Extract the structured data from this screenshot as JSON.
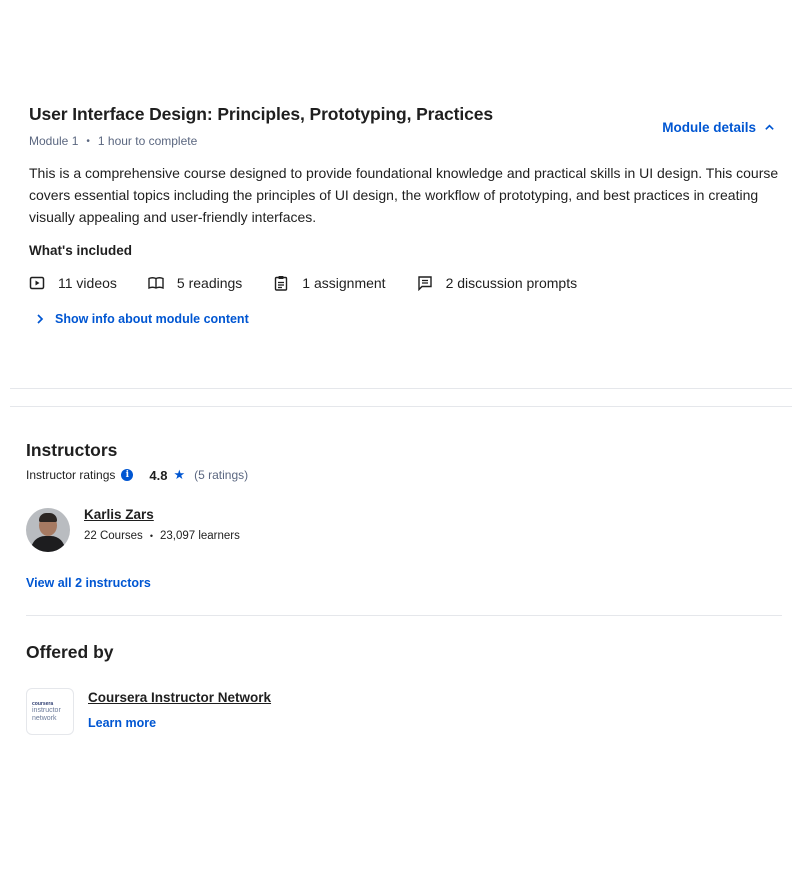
{
  "module": {
    "title": "User Interface Design: Principles, Prototyping, Practices",
    "number": "Module 1",
    "duration": "1 hour to complete",
    "details_label": "Module details",
    "description": "This is a comprehensive course designed to provide foundational knowledge and practical skills in UI design. This course covers essential topics including the principles of UI design, the workflow of prototyping, and best practices in creating visually appealing and user-friendly interfaces.",
    "included_title": "What's included",
    "included": [
      {
        "icon": "video-icon",
        "label": "11 videos"
      },
      {
        "icon": "book-icon",
        "label": "5 readings"
      },
      {
        "icon": "clipboard-icon",
        "label": "1 assignment"
      },
      {
        "icon": "chat-icon",
        "label": "2 discussion prompts"
      }
    ],
    "show_info_label": "Show info about module content"
  },
  "instructors": {
    "title": "Instructors",
    "ratings_label": "Instructor ratings",
    "rating_value": "4.8",
    "rating_count": "(5 ratings)",
    "list": [
      {
        "name": "Karlis Zars",
        "courses": "22 Courses",
        "learners": "23,097 learners"
      }
    ],
    "view_all_label": "View all 2 instructors"
  },
  "offered_by": {
    "title": "Offered by",
    "logo_line1": "coursera",
    "logo_line2": "instructor",
    "logo_line3": "network",
    "partner_name": "Coursera Instructor Network",
    "learn_more_label": "Learn more"
  },
  "colors": {
    "accent": "#0056d2",
    "text": "#1f1f1f",
    "muted": "#5b6780",
    "divider": "#e5e7eb"
  }
}
